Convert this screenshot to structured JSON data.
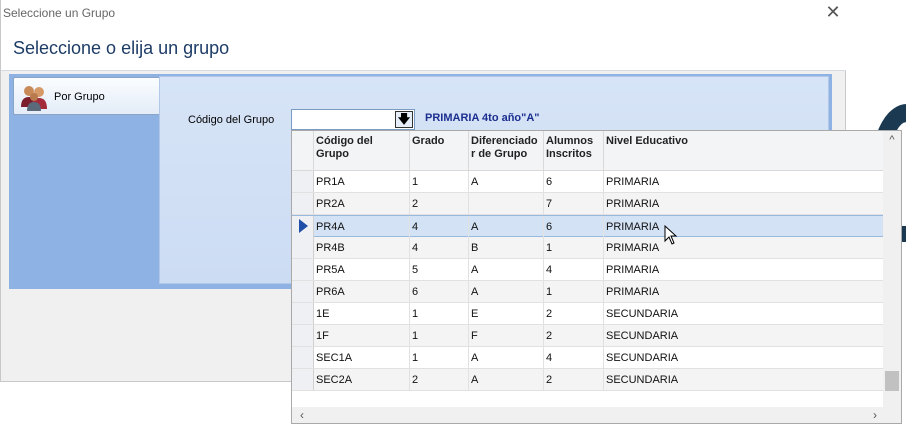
{
  "window": {
    "title": "Seleccione un Grupo",
    "header": "Seleccione o elija un grupo"
  },
  "nav": {
    "button_label": "Por Grupo"
  },
  "form": {
    "field_label": "Código del Grupo",
    "combo_value": "",
    "group_description": "PRIMARIA 4to año\"A\""
  },
  "grid": {
    "columns": [
      "Código del Grupo",
      "Grado",
      "Diferenciador de Grupo",
      "Alumnos Inscritos",
      "Nivel Educativo"
    ],
    "column_lines": [
      [
        "Código del",
        "Grupo"
      ],
      [
        "Grado",
        ""
      ],
      [
        "Diferenciado",
        "r de Grupo"
      ],
      [
        "Alumnos",
        "Inscritos"
      ],
      [
        "Nivel Educativo",
        ""
      ]
    ],
    "rows": [
      [
        "PR1A",
        "1",
        "A",
        "6",
        "PRIMARIA"
      ],
      [
        "PR2A",
        "2",
        "",
        "7",
        "PRIMARIA"
      ],
      [
        "PR4A",
        "4",
        "A",
        "6",
        "PRIMARIA"
      ],
      [
        "PR4B",
        "4",
        "B",
        "1",
        "PRIMARIA"
      ],
      [
        "PR5A",
        "5",
        "A",
        "4",
        "PRIMARIA"
      ],
      [
        "PR6A",
        "6",
        "A",
        "1",
        "PRIMARIA"
      ],
      [
        "1E",
        "1",
        "E",
        "2",
        "SECUNDARIA"
      ],
      [
        "1F",
        "1",
        "F",
        "2",
        "SECUNDARIA"
      ],
      [
        "SEC1A",
        "1",
        "A",
        "4",
        "SECUNDARIA"
      ],
      [
        "SEC2A",
        "2",
        "A",
        "2",
        "SECUNDARIA"
      ]
    ],
    "selected_row": 2
  },
  "colors": {
    "header_text": "#1d3c66",
    "panel_blue": "#8db2e3",
    "selection": "#d3e2f5",
    "desc_text": "#1a2f8f"
  },
  "icons": {
    "close": "close-icon",
    "dropdown": "dropdown-arrow-icon",
    "nav": "users-group-icon",
    "cursor": "mouse-pointer-icon"
  }
}
